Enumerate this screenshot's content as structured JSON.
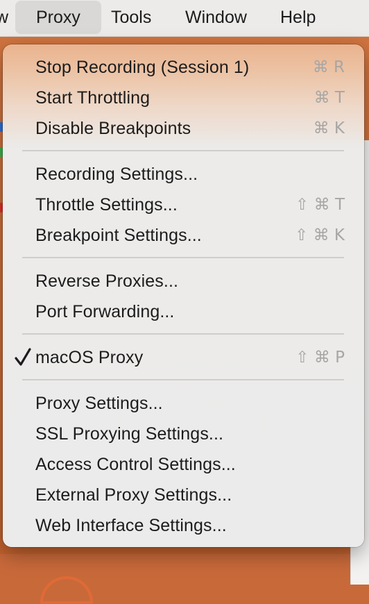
{
  "menubar": {
    "items": [
      {
        "label": "w"
      },
      {
        "label": "Proxy"
      },
      {
        "label": "Tools"
      },
      {
        "label": "Window"
      },
      {
        "label": "Help"
      }
    ]
  },
  "menu": {
    "items": [
      {
        "label": "Stop Recording (Session 1)",
        "shortcut": "⌘ R"
      },
      {
        "label": "Start Throttling",
        "shortcut": "⌘ T"
      },
      {
        "label": "Disable Breakpoints",
        "shortcut": "⌘ K"
      },
      {
        "label": "Recording Settings..."
      },
      {
        "label": "Throttle Settings...",
        "shortcut": "⇧ ⌘ T"
      },
      {
        "label": "Breakpoint Settings...",
        "shortcut": "⇧ ⌘ K"
      },
      {
        "label": "Reverse Proxies..."
      },
      {
        "label": "Port Forwarding..."
      },
      {
        "label": "macOS Proxy",
        "shortcut": "⇧ ⌘ P",
        "checked": true
      },
      {
        "label": "Proxy Settings..."
      },
      {
        "label": "SSL Proxying Settings..."
      },
      {
        "label": "Access Control Settings..."
      },
      {
        "label": "External Proxy Settings..."
      },
      {
        "label": "Web Interface Settings..."
      }
    ]
  },
  "colors": {
    "accent": "#c8693a",
    "menu_tint": "#eab38e",
    "menu_bg": "#ebebeb",
    "shortcut_text": "#a8a6a4"
  },
  "icons": {
    "checkmark": "checkmark-icon"
  }
}
